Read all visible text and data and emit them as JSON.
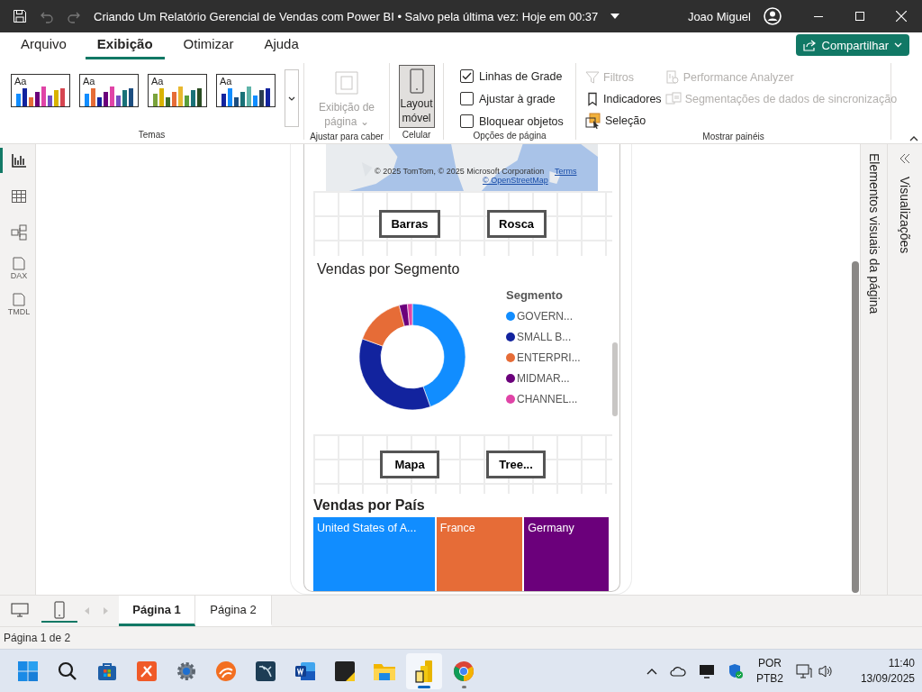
{
  "title_bar": {
    "title": "Criando Um Relatório Gerencial de Vendas com Power BI • Salvo pela última vez: Hoje em 00:37",
    "user": "Joao Miguel"
  },
  "menu_tabs": [
    {
      "label": "Arquivo",
      "selected": false
    },
    {
      "label": "Exibição",
      "selected": true
    },
    {
      "label": "Otimizar",
      "selected": false
    },
    {
      "label": "Ajuda",
      "selected": false
    }
  ],
  "share_button": "Compartilhar",
  "ribbon": {
    "themes": {
      "group": "Temas",
      "items": [
        {
          "text": "Aa",
          "selected": false
        },
        {
          "text": "Aa",
          "selected": false
        },
        {
          "text": "Aa",
          "selected": false
        },
        {
          "text": "Aa",
          "selected": false
        }
      ]
    },
    "fit": {
      "group": "Ajustar para caber",
      "label": "Exibição de página",
      "caret": "⌄",
      "disabled": true
    },
    "mobile": {
      "group": "Celular",
      "label": "Layout móvel",
      "selected": true
    },
    "page_options": {
      "group": "Opções de página",
      "checkboxes": [
        {
          "label": "Linhas de Grade",
          "checked": true
        },
        {
          "label": "Ajustar à grade",
          "checked": false
        },
        {
          "label": "Bloquear objetos",
          "checked": false
        }
      ]
    },
    "panes": {
      "group": "Mostrar painéis",
      "items": [
        {
          "kind": "filter",
          "label": "Filtros",
          "disabled": true
        },
        {
          "kind": "bookmark",
          "label": "Indicadores",
          "disabled": false
        },
        {
          "kind": "selection",
          "label": "Seleção",
          "disabled": false
        },
        {
          "kind": "performance",
          "label": "Performance Analyzer",
          "disabled": true
        },
        {
          "kind": "sync",
          "label": "Segmentações de dados de sincronização",
          "disabled": true
        }
      ]
    }
  },
  "left_rail": [
    {
      "kind": "report",
      "selected": true
    },
    {
      "kind": "table",
      "selected": false
    },
    {
      "kind": "model",
      "selected": false
    },
    {
      "kind": "file",
      "badge": "DAX",
      "selected": false
    },
    {
      "kind": "file",
      "badge": "TMDL",
      "selected": false
    }
  ],
  "canvas": {
    "map": {
      "attribution": "© 2025 TomTom, © 2025 Microsoft Corporation",
      "terms": "Terms",
      "osm": "© OpenStreetMap"
    },
    "nav_rows": [
      [
        "Barras",
        "Rosca"
      ],
      [
        "Mapa",
        "Tree..."
      ]
    ],
    "segment_chart": {
      "title": "Vendas por Segmento",
      "legend_title": "Segmento",
      "legend": [
        {
          "label": "GOVERN...",
          "color": "#118dff"
        },
        {
          "label": "SMALL B...",
          "color": "#12239e"
        },
        {
          "label": "ENTERPRI...",
          "color": "#e66c37"
        },
        {
          "label": "MIDMAR...",
          "color": "#6b007b"
        },
        {
          "label": "CHANNEL...",
          "color": "#e044a7"
        }
      ]
    },
    "country_chart": {
      "title": "Vendas por País",
      "tiles": [
        {
          "label": "United States of A...",
          "color": "#118dff"
        },
        {
          "label": "France",
          "color": "#e66c37"
        },
        {
          "label": "Germany",
          "color": "#6b007b"
        }
      ]
    }
  },
  "right_panes": [
    "Elementos visuais da página",
    "Visualizações"
  ],
  "view_toggle": [
    {
      "kind": "desktop",
      "selected": false
    },
    {
      "kind": "mobile",
      "selected": true
    }
  ],
  "page_tabs": [
    {
      "label": "Página 1",
      "selected": true
    },
    {
      "label": "Página 2",
      "selected": false
    }
  ],
  "status_bar": "Página 1 de 2",
  "taskbar": {
    "apps": [
      {
        "kind": "start",
        "selected": false,
        "running": false
      },
      {
        "kind": "search",
        "selected": false,
        "running": false
      },
      {
        "kind": "store",
        "selected": false,
        "running": false
      },
      {
        "kind": "orange",
        "selected": false,
        "running": false
      },
      {
        "kind": "gear",
        "selected": false,
        "running": false
      },
      {
        "kind": "round",
        "selected": false,
        "running": false
      },
      {
        "kind": "dolphin",
        "selected": false,
        "running": false
      },
      {
        "kind": "word",
        "selected": false,
        "running": false
      },
      {
        "kind": "note",
        "selected": false,
        "running": false
      },
      {
        "kind": "folder",
        "selected": false,
        "running": false
      },
      {
        "kind": "powerbi",
        "selected": true,
        "running": true
      },
      {
        "kind": "chrome",
        "selected": false,
        "running": true
      }
    ],
    "language": "POR",
    "layout": "PTB2",
    "time": "11:40",
    "date": "13/09/2025"
  }
}
